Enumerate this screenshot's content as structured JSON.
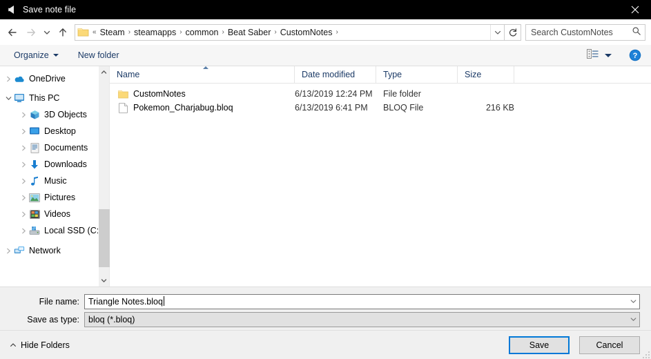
{
  "window": {
    "title": "Save note file",
    "icon": "unity-speaker-icon",
    "close_label": "×"
  },
  "nav": {
    "back": "back-arrow",
    "forward": "forward-arrow",
    "recent": "recent-locations-chevron",
    "up": "up-arrow",
    "refresh_title": "Refresh",
    "breadcrumb_prefix": "«",
    "breadcrumbs": [
      {
        "label": "Steam"
      },
      {
        "label": "steamapps"
      },
      {
        "label": "common"
      },
      {
        "label": "Beat Saber"
      },
      {
        "label": "CustomNotes"
      }
    ],
    "separator": "›"
  },
  "search": {
    "placeholder": "Search CustomNotes",
    "icon": "search-icon"
  },
  "toolbar": {
    "organize_label": "Organize",
    "new_folder_label": "New folder",
    "view_icon": "view-layout-icon",
    "help_icon": "help-icon"
  },
  "sidebar": {
    "items": [
      {
        "label": "OneDrive",
        "icon": "onedrive-cloud-icon",
        "indent": 0,
        "expanded": false
      },
      {
        "label": "This PC",
        "icon": "this-pc-monitor-icon",
        "indent": 0,
        "expanded": true
      },
      {
        "label": "3D Objects",
        "icon": "3d-objects-icon",
        "indent": 1,
        "expanded": false
      },
      {
        "label": "Desktop",
        "icon": "desktop-icon",
        "indent": 1,
        "expanded": false
      },
      {
        "label": "Documents",
        "icon": "documents-icon",
        "indent": 1,
        "expanded": false
      },
      {
        "label": "Downloads",
        "icon": "downloads-arrow-icon",
        "indent": 1,
        "expanded": false
      },
      {
        "label": "Music",
        "icon": "music-note-icon",
        "indent": 1,
        "expanded": false
      },
      {
        "label": "Pictures",
        "icon": "pictures-icon",
        "indent": 1,
        "expanded": false
      },
      {
        "label": "Videos",
        "icon": "videos-film-icon",
        "indent": 1,
        "expanded": false
      },
      {
        "label": "Local SSD (C:)",
        "icon": "drive-icon",
        "indent": 1,
        "expanded": false
      },
      {
        "label": "Network",
        "icon": "network-icon",
        "indent": 0,
        "expanded": false
      }
    ]
  },
  "filelist": {
    "columns": [
      {
        "label": "Name"
      },
      {
        "label": "Date modified"
      },
      {
        "label": "Type"
      },
      {
        "label": "Size"
      }
    ],
    "sort_column": "Name",
    "sort_direction": "ascending",
    "rows": [
      {
        "name": "CustomNotes",
        "date": "6/13/2019 12:24 PM",
        "type": "File folder",
        "size": "",
        "icon": "folder-icon"
      },
      {
        "name": "Pokemon_Charjabug.bloq",
        "date": "6/13/2019 6:41 PM",
        "type": "BLOQ File",
        "size": "216 KB",
        "icon": "file-icon"
      }
    ]
  },
  "form": {
    "filename_label": "File name:",
    "filename_value": "Triangle Notes.bloq",
    "savetype_label": "Save as type:",
    "savetype_value": "bloq (*.bloq)"
  },
  "footer": {
    "hide_folders_label": "Hide Folders",
    "save_label": "Save",
    "cancel_label": "Cancel"
  },
  "colors": {
    "titlebar": "#000000",
    "accent": "#0078d7",
    "dialog_bg": "#f0f0f0",
    "folder_yellow": "#fbd978",
    "link_blue": "#1b3a66"
  }
}
